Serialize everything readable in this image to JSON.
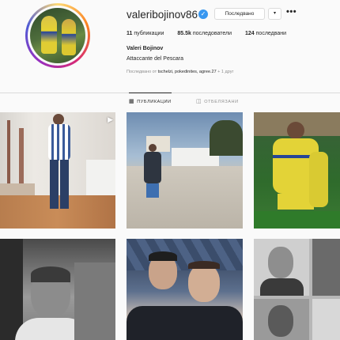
{
  "profile": {
    "username": "valeribojinov86",
    "follow_label": "Последвано",
    "dropdown_glyph": "▾",
    "more_glyph": "•••",
    "verified_glyph": "✓",
    "stats": {
      "posts_count": "11",
      "posts_label": "публикации",
      "followers_count": "85.5k",
      "followers_label": "последователи",
      "following_count": "124",
      "following_label": "последвани"
    },
    "full_name": "Valeri Bojinov",
    "bio": "Attaccante del Pescara",
    "followed_by_prefix": "Последвано от ",
    "followed_by_names": "tschelzi, pokedinites, agree.27",
    "followed_by_suffix": " + 1 друг"
  },
  "tabs": [
    {
      "label": "ПУБЛИКАЦИИ",
      "icon": "grid-icon",
      "glyph": "▦",
      "active": true
    },
    {
      "label": "ОТБЕЛЯЗАНИ",
      "icon": "tag-icon",
      "glyph": "◫",
      "active": false
    }
  ],
  "posts": [
    {
      "kind": "video",
      "icon_glyph": "▶"
    },
    {
      "kind": "photo"
    },
    {
      "kind": "photo"
    },
    {
      "kind": "photo"
    },
    {
      "kind": "photo"
    },
    {
      "kind": "photo"
    }
  ],
  "colors": {
    "background": "#fafafa",
    "verified": "#3897f0",
    "muted": "#8e8e8e",
    "text": "#262626"
  }
}
